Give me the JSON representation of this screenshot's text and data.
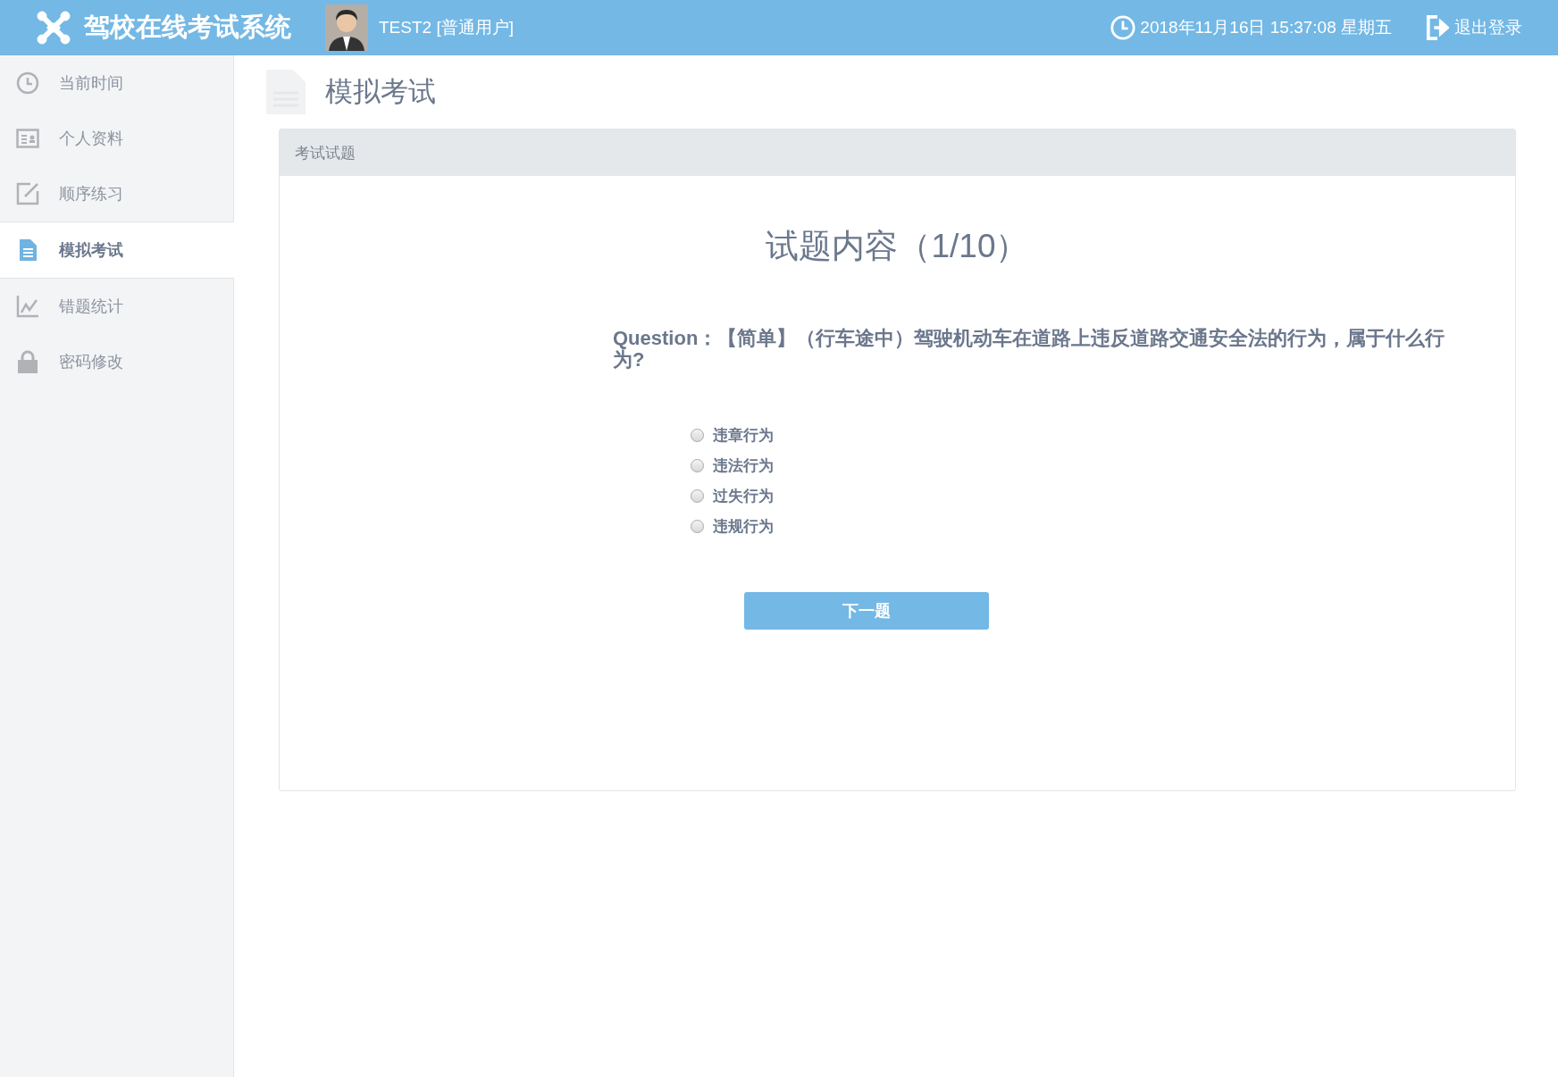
{
  "header": {
    "title": "驾校在线考试系统",
    "user": "TEST2 [普通用户]",
    "datetime": "2018年11月16日 15:37:08 星期五",
    "logout": "退出登录"
  },
  "sidebar": {
    "items": [
      {
        "kind": "clock",
        "label": "当前时间",
        "selected": false
      },
      {
        "kind": "profile",
        "label": "个人资料",
        "selected": false
      },
      {
        "kind": "edit",
        "label": "顺序练习",
        "selected": false
      },
      {
        "kind": "document",
        "label": "模拟考试",
        "selected": true
      },
      {
        "kind": "chart",
        "label": "错题统计",
        "selected": false
      },
      {
        "kind": "lock",
        "label": "密码修改",
        "selected": false
      }
    ]
  },
  "page": {
    "title": "模拟考试"
  },
  "panel": {
    "heading": "考试试题",
    "title": "试题内容（1/10）",
    "question": "Question：【简单】（行车途中）驾驶机动车在道路上违反道路交通安全法的行为，属于什么行为?",
    "options": [
      {
        "label": "违章行为",
        "selected": false
      },
      {
        "label": "违法行为",
        "selected": false
      },
      {
        "label": "过失行为",
        "selected": false
      },
      {
        "label": "违规行为",
        "selected": false
      }
    ],
    "next_button": "下一题"
  }
}
